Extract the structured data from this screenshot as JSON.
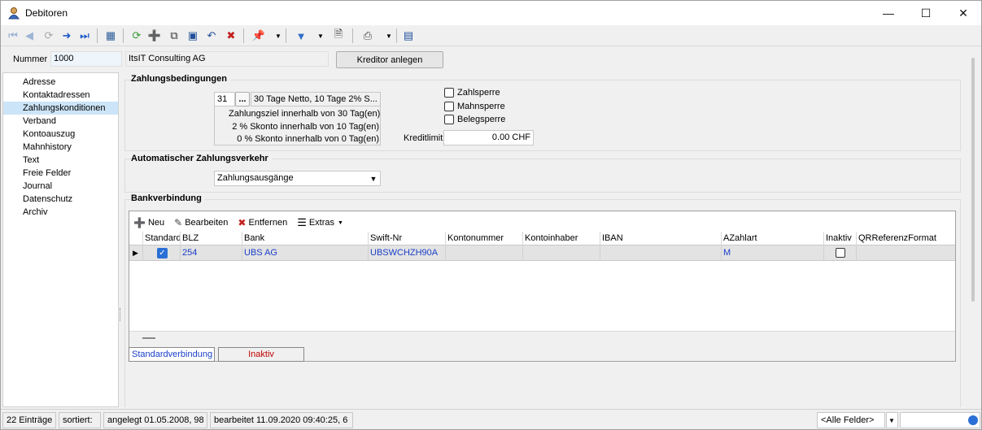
{
  "window": {
    "title": "Debitoren"
  },
  "header": {
    "nummer_label": "Nummer",
    "nummer_value": "1000",
    "name_value": "ItsIT Consulting AG",
    "kreditor_button": "Kreditor anlegen"
  },
  "sidebar": {
    "items": [
      {
        "label": "Adresse"
      },
      {
        "label": "Kontaktadressen"
      },
      {
        "label": "Zahlungskonditionen",
        "selected": true
      },
      {
        "label": "Verband"
      },
      {
        "label": "Kontoauszug"
      },
      {
        "label": "Mahnhistory"
      },
      {
        "label": "Text"
      },
      {
        "label": "Freie Felder"
      },
      {
        "label": "Journal"
      },
      {
        "label": "Datenschutz"
      },
      {
        "label": "Archiv"
      }
    ]
  },
  "zahlungsbedingungen": {
    "title": "Zahlungsbedingungen",
    "code": "31",
    "dots": "...",
    "description": "30 Tage Netto, 10 Tage 2% S...",
    "line1": "Zahlungsziel innerhalb von 30 Tag(en)",
    "line2": "2 % Skonto innerhalb von 10 Tag(en)",
    "line3": "0  % Skonto innerhalb von 0 Tag(en)",
    "zahlsperre": "Zahlsperre",
    "mahnsperre": "Mahnsperre",
    "belegsperre": "Belegsperre",
    "kreditlimit_label": "Kreditlimit",
    "kreditlimit_value": "0.00 CHF"
  },
  "auto": {
    "title": "Automatischer Zahlungsverkehr",
    "select_value": "Zahlungsausgänge"
  },
  "bank": {
    "title": "Bankverbindung",
    "toolbar": {
      "neu": "Neu",
      "bearbeiten": "Bearbeiten",
      "entfernen": "Entfernen",
      "extras": "Extras"
    },
    "columns": [
      "Standard",
      "BLZ",
      "Bank",
      "Swift-Nr",
      "Kontonummer",
      "Kontoinhaber",
      "IBAN",
      "AZahlart",
      "Inaktiv",
      "QRReferenzFormat"
    ],
    "rows": [
      {
        "standard": true,
        "blz": "254",
        "bank": "UBS AG",
        "swift": "UBSWCHZH90A",
        "kontonummer": "",
        "kontoinhaber": "",
        "iban": "",
        "azahlart": "M",
        "inaktiv": false,
        "qr": ""
      }
    ],
    "legend_standard": "Standardverbindung",
    "legend_inaktiv": "Inaktiv",
    "colors": {
      "standard": "#1a3ec8",
      "inaktiv": "#c00000"
    }
  },
  "status": {
    "count": "22 Einträge",
    "sortiert": "sortiert:",
    "angelegt": "angelegt 01.05.2008, 98",
    "bearbeitet": "bearbeitet 11.09.2020 09:40:25,  6",
    "filter": "<Alle Felder>"
  }
}
